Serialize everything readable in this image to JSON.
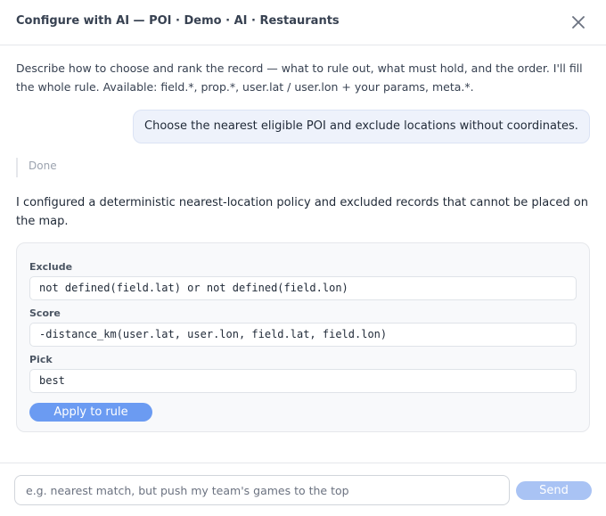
{
  "dialog": {
    "title": "Configure with AI — POI · Demo · AI · Restaurants",
    "close_icon": "close-icon"
  },
  "intro": "Describe how to choose and rank the record — what to rule out, what must hold, and the order. I'll fill the whole rule. Available: field.*, prop.*, user.lat / user.lon + your params, meta.*.",
  "user_message": "Choose the nearest eligible POI and exclude locations without coordinates.",
  "status": "Done",
  "assistant_reply": "I configured a deterministic nearest-location policy and excluded records that cannot be placed on the map.",
  "rule": {
    "exclude_label": "Exclude",
    "exclude_value": "not defined(field.lat) or not defined(field.lon)",
    "score_label": "Score",
    "score_value": "-distance_km(user.lat, user.lon, field.lat, field.lon)",
    "pick_label": "Pick",
    "pick_value": "best",
    "apply_label": "Apply to rule"
  },
  "composer": {
    "placeholder": "e.g. nearest match, but push my team's games to the top",
    "send_label": "Send"
  },
  "colors": {
    "accent": "#6b9bf2",
    "accent_disabled": "#a9c3f4",
    "user_bubble_bg": "#eef2fb",
    "card_bg": "#f8f9fb"
  }
}
